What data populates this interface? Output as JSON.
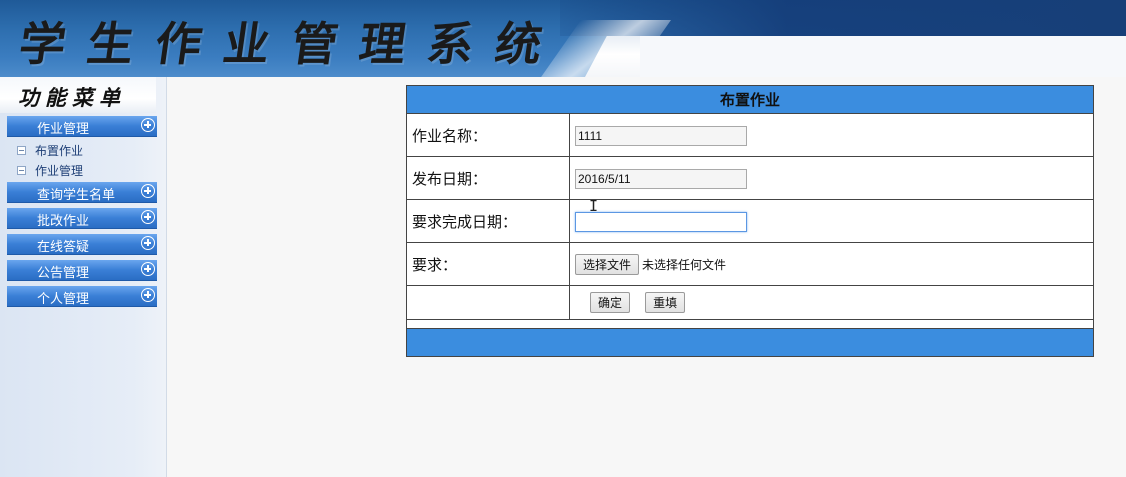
{
  "header": {
    "title": "学生作业管理系统"
  },
  "sidebar": {
    "menu_title": "功能菜单",
    "groups": [
      {
        "label": "作业管理",
        "sub_items": [
          "布置作业",
          "作业管理"
        ]
      },
      {
        "label": "查询学生名单"
      },
      {
        "label": "批改作业"
      },
      {
        "label": "在线答疑"
      },
      {
        "label": "公告管理"
      },
      {
        "label": "个人管理"
      }
    ]
  },
  "form": {
    "title": "布置作业",
    "rows": [
      {
        "label": "作业名称：",
        "value": "1111"
      },
      {
        "label": "发布日期：",
        "value": "2016/5/11"
      },
      {
        "label": "要求完成日期：",
        "value": ""
      },
      {
        "label": "要求：",
        "file_button": "选择文件",
        "file_status": "未选择任何文件"
      }
    ],
    "confirm_label": "确定",
    "reset_label": "重填"
  },
  "colors": {
    "banner_blue": "#2e6fb0",
    "menu_bar_blue": "#3a7fd6",
    "table_header_blue": "#3b8ddf"
  }
}
